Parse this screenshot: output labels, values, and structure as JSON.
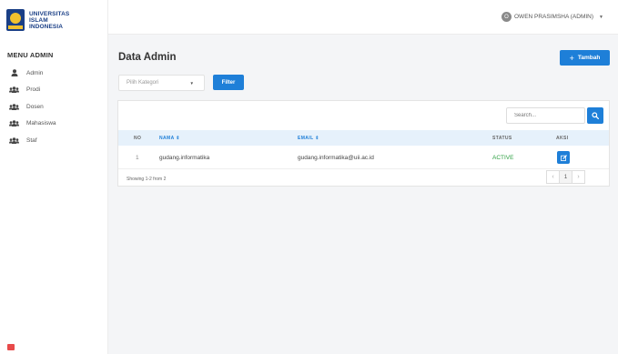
{
  "brand": {
    "logo_lines": [
      "UNIVERSITAS",
      "ISLAM",
      "INDONESIA"
    ]
  },
  "sidebar": {
    "menu_title": "MENU ADMIN",
    "items": [
      {
        "label": "Admin",
        "icon": "user-icon"
      },
      {
        "label": "Prodi",
        "icon": "users-icon"
      },
      {
        "label": "Dosen",
        "icon": "users-icon"
      },
      {
        "label": "Mahasiswa",
        "icon": "users-icon"
      },
      {
        "label": "Staf",
        "icon": "users-icon"
      }
    ]
  },
  "topbar": {
    "avatar_initial": "O",
    "user_name": "OWEN PRASIMSHA (ADMIN)",
    "caret": "▼"
  },
  "page": {
    "title": "Data Admin",
    "add_button": "Tambah",
    "add_button_icon": "+",
    "category_placeholder": "Pilih Kategori",
    "filter_button": "Filter",
    "search_placeholder": "Search..."
  },
  "table": {
    "headers": {
      "no": "NO",
      "nama": "NAMA ⇕",
      "email": "EMAIL ⇕",
      "status": "STATUS",
      "aksi": "AKSI"
    },
    "rows": [
      {
        "no": "1",
        "nama": "gudang.informatika",
        "email": "gudang.informatika@uii.ac.id",
        "status": "ACTIVE"
      }
    ],
    "footer_info": "Showing 1-2 from 2",
    "pagination": {
      "prev": "‹",
      "current": "1",
      "next": "›"
    }
  },
  "colors": {
    "accent": "#1e7fd8",
    "brand_navy": "#1a3f86",
    "brand_gold": "#f2c12e",
    "status_active": "#2ea043",
    "table_header_bg": "#e6f1fb"
  }
}
